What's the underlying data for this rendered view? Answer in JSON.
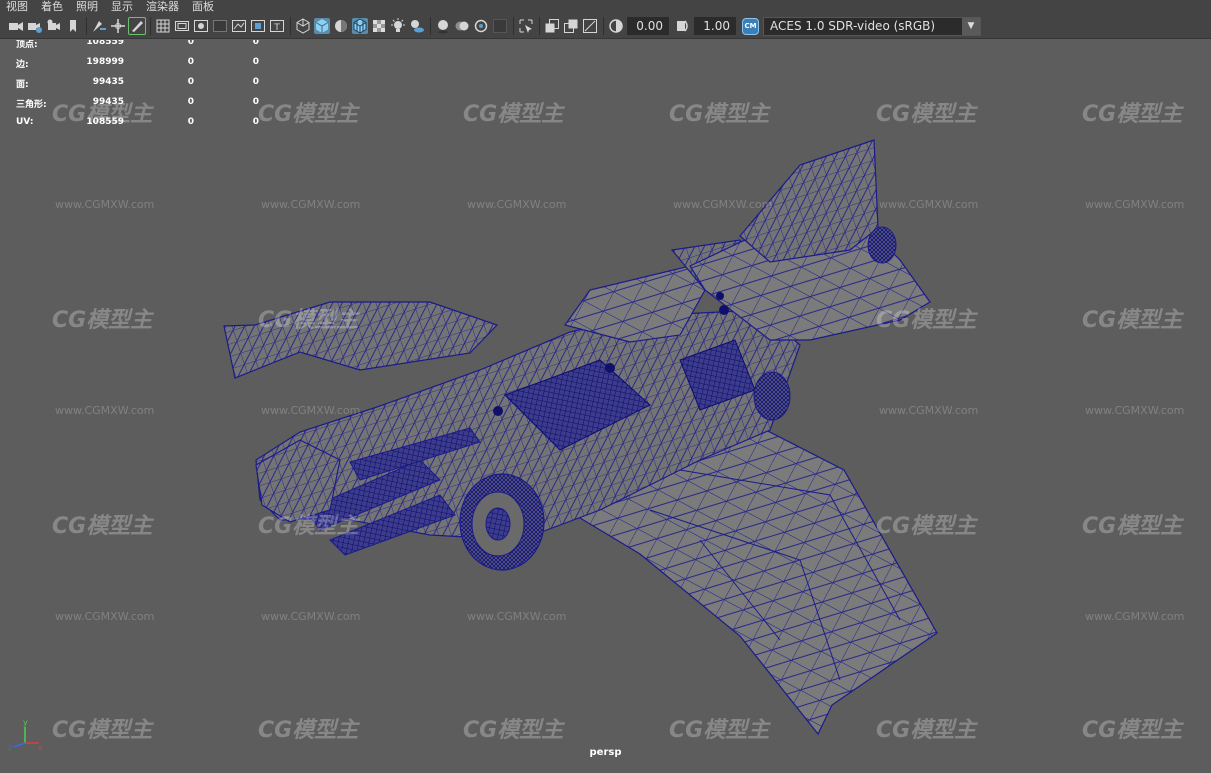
{
  "menu": {
    "items": [
      "视图",
      "着色",
      "照明",
      "显示",
      "渲染器",
      "面板"
    ]
  },
  "toolbar": {
    "icons": [
      "select-camera-icon",
      "camera-attributes-icon",
      "bookmark-icon",
      "image-plane-icon",
      "grease-pencil-icon",
      "2d-pan-zoom-icon",
      "grid-icon",
      "film-gate-icon",
      "resolution-gate-icon",
      "gate-mask-icon",
      "field-chart-icon",
      "safe-action-icon",
      "safe-title-icon",
      "wireframe-icon",
      "smooth-shade-all-icon",
      "default-material-icon",
      "wireframe-on-shaded-icon",
      "xray-icon",
      "use-all-lights-icon",
      "shadows-icon",
      "screen-space-ao-icon",
      "motion-blur-icon",
      "anti-aliasing-icon",
      "depth-of-field-icon",
      "isolate-select-icon",
      "xray-active-icon",
      "xray-joints-icon",
      "backface-culling-icon"
    ],
    "exposure": "0.00",
    "gamma": "1.00",
    "color_management_badge": "CM",
    "color_space": "ACES 1.0 SDR-video (sRGB)"
  },
  "hud": {
    "rows": [
      {
        "label": "顶点:",
        "v1": "108559",
        "v2": "0",
        "v3": "0"
      },
      {
        "label": "边:",
        "v1": "198999",
        "v2": "0",
        "v3": "0"
      },
      {
        "label": "面:",
        "v1": "99435",
        "v2": "0",
        "v3": "0"
      },
      {
        "label": "三角形:",
        "v1": "99435",
        "v2": "0",
        "v3": "0"
      },
      {
        "label": "UV:",
        "v1": "108559",
        "v2": "0",
        "v3": "0"
      }
    ]
  },
  "viewport": {
    "camera": "persp",
    "wire_color": "#1a1a8a",
    "mesh_color": "#7a7a7a",
    "background": "#5d5d5d"
  },
  "axis": {
    "x_label": "x",
    "y_label": "y",
    "z_label": "z",
    "x_color": "#e03c3c",
    "y_color": "#4ccf4c",
    "z_color": "#3c6ae0"
  },
  "watermark": {
    "logo": "CG模型主",
    "url": "www.CGMXW.com"
  }
}
